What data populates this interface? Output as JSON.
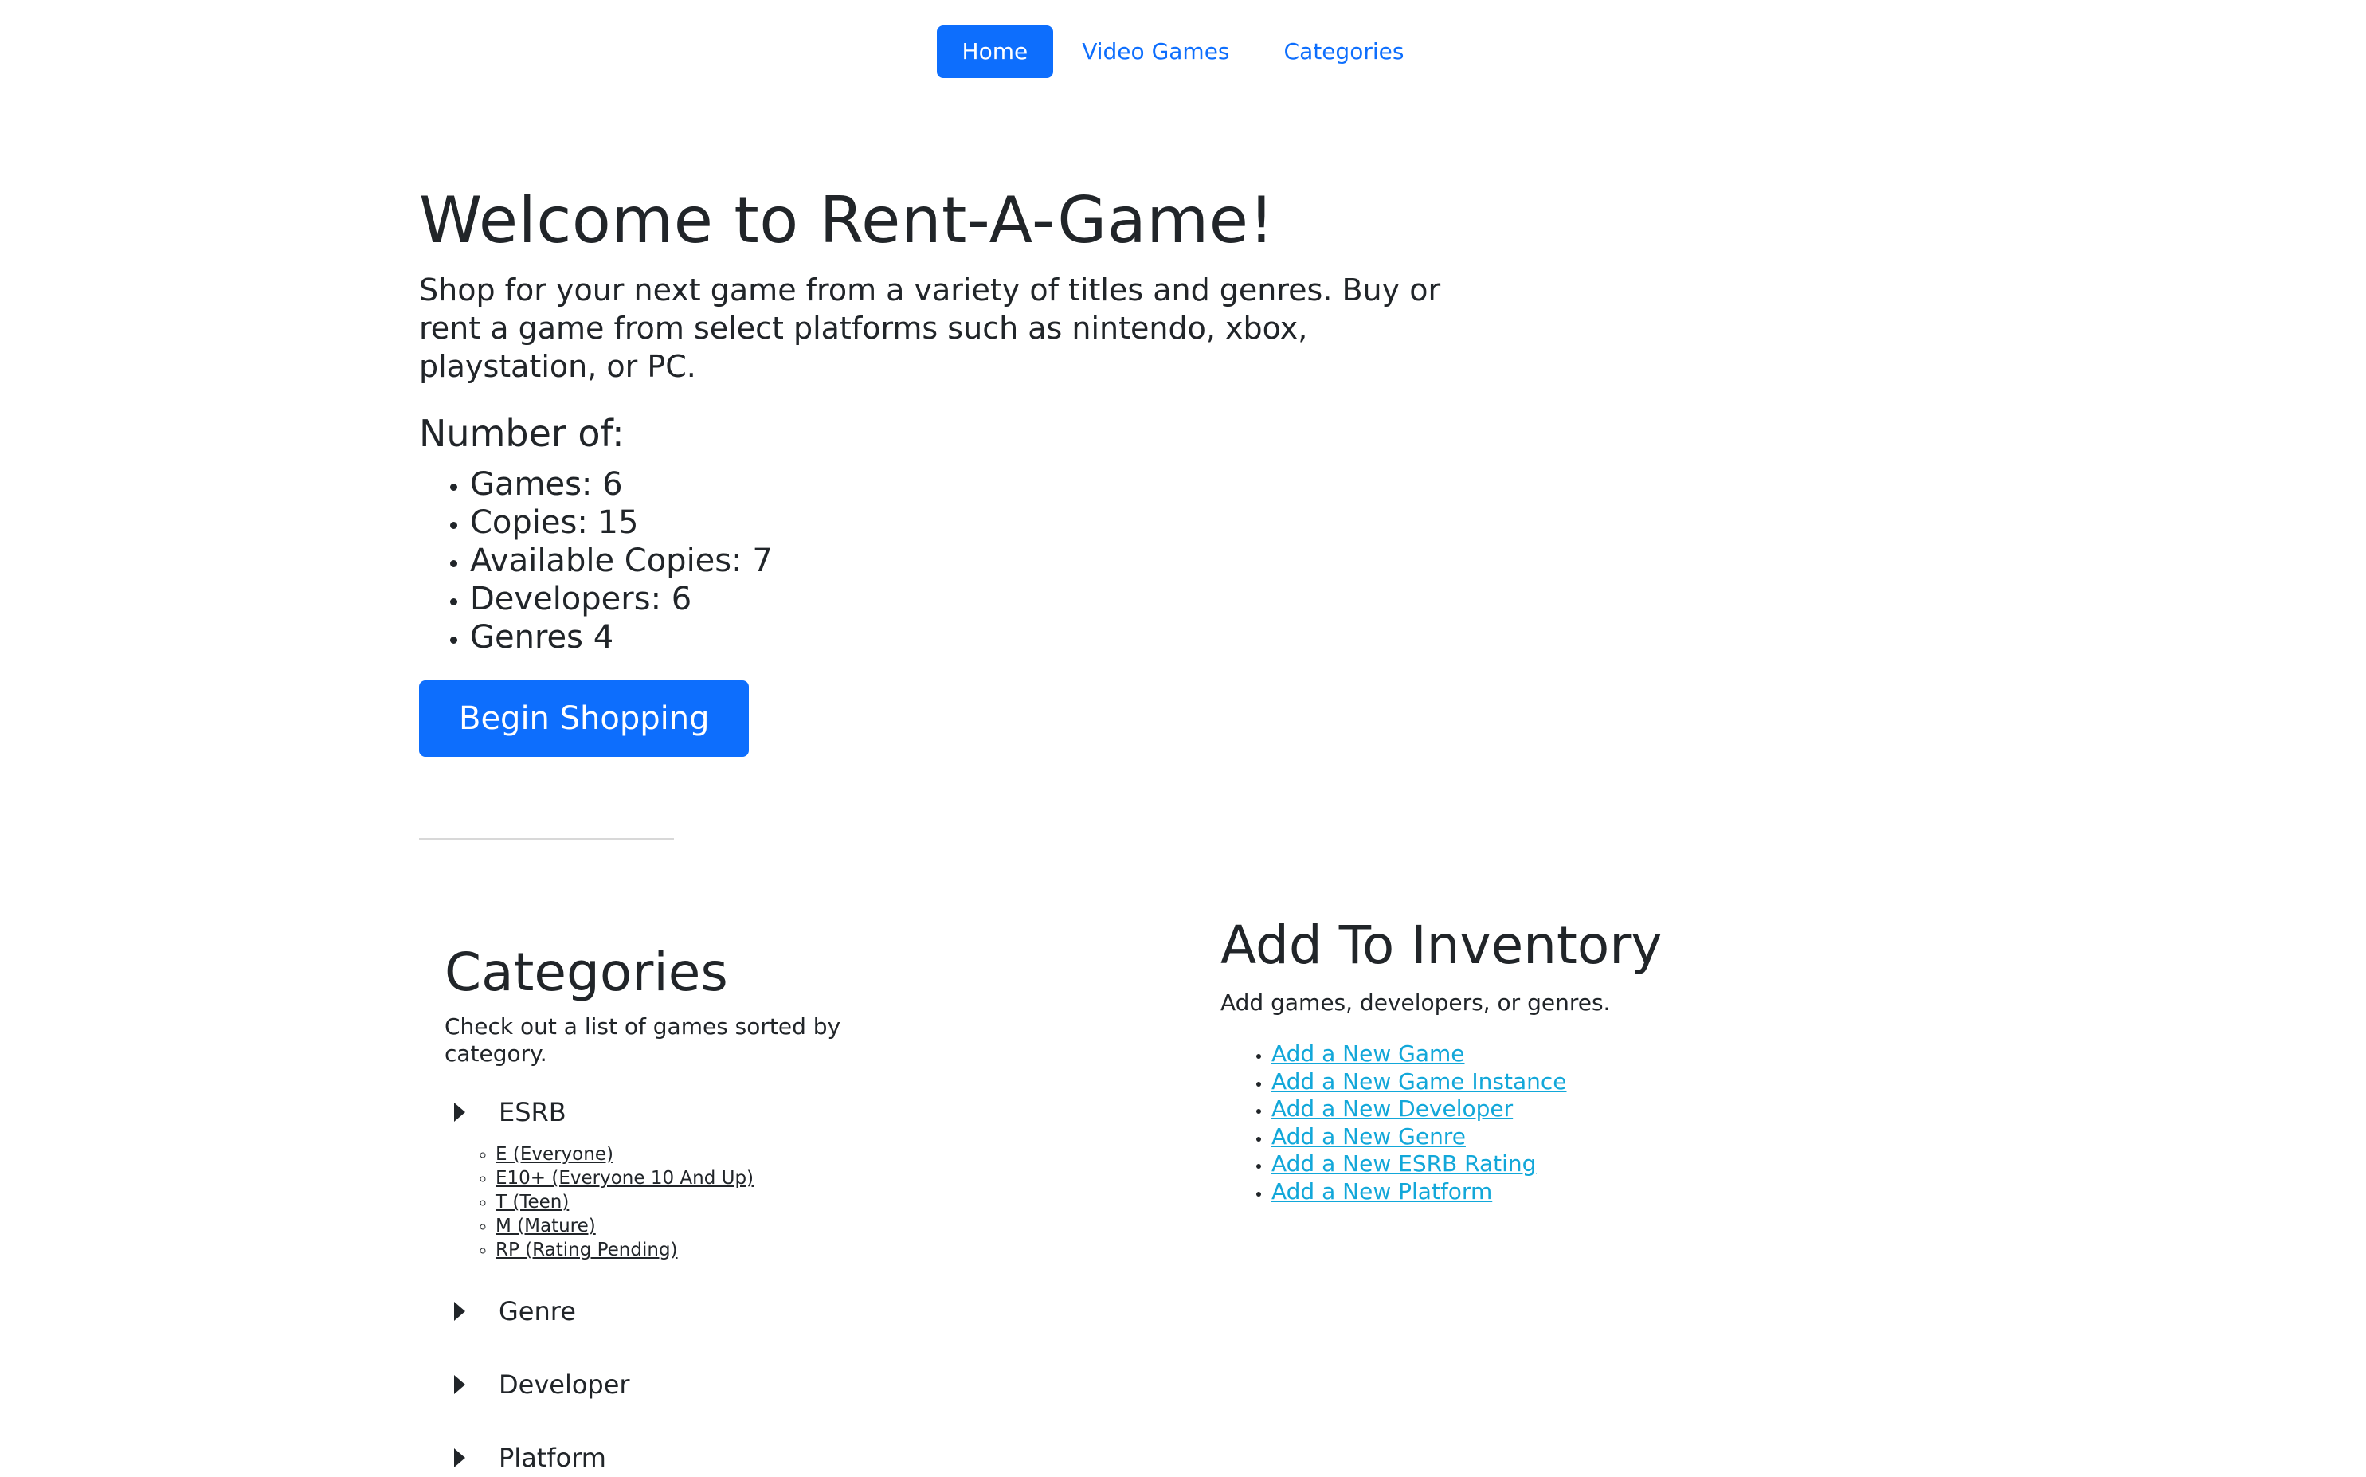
{
  "nav": {
    "items": [
      "Home",
      "Video Games",
      "Categories"
    ]
  },
  "hero": {
    "title": "Welcome to Rent-A-Game!",
    "lead": "Shop for your next game from a variety of titles and genres. Buy or rent a game from select platforms such as nintendo, xbox, playstation, or PC.",
    "count_heading": "Number of:",
    "stats": [
      "Games: 6",
      "Copies: 15",
      "Available Copies: 7",
      "Developers: 6",
      "Genres 4"
    ],
    "button": "Begin Shopping"
  },
  "categories": {
    "title": "Categories",
    "description": "Check out a list of games sorted by category.",
    "groups": [
      {
        "label": "ESRB",
        "expanded": true,
        "items": [
          "E (Everyone)",
          "E10+ (Everyone 10 And Up)",
          "T (Teen)",
          "M (Mature)",
          "RP (Rating Pending)"
        ]
      },
      {
        "label": "Genre",
        "expanded": false
      },
      {
        "label": "Developer",
        "expanded": false
      },
      {
        "label": "Platform",
        "expanded": false
      }
    ]
  },
  "inventory": {
    "title": "Add To Inventory",
    "description": "Add games, developers, or genres.",
    "links": [
      "Add a New Game",
      "Add a New Game Instance",
      "Add a New Developer",
      "Add a New Genre",
      "Add a New ESRB Rating",
      "Add a New Platform"
    ]
  },
  "colors": {
    "primary": "#0d6efd",
    "link_cyan": "#12a7d9",
    "text": "#212529"
  }
}
